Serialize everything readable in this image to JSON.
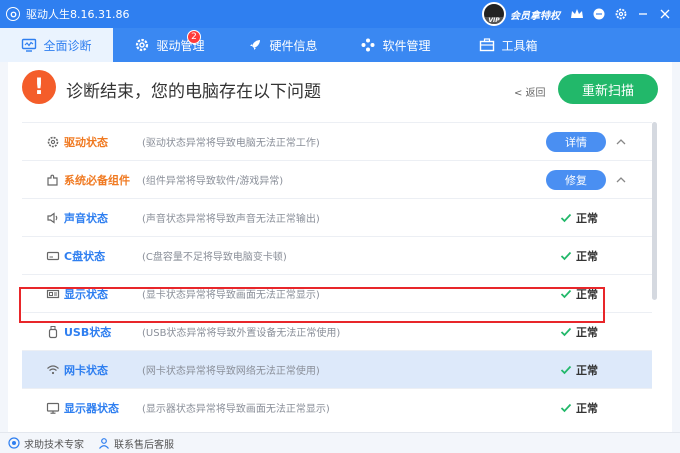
{
  "titlebar": {
    "app_title": "驱动人生8.16.31.86",
    "member_label": "会员拿特权",
    "vip_tag": "VIP"
  },
  "nav": {
    "tabs": [
      {
        "label": "全面诊断",
        "icon": "monitor-icon",
        "active": true
      },
      {
        "label": "驱动管理",
        "icon": "gear-icon",
        "badge": "2"
      },
      {
        "label": "硬件信息",
        "icon": "rocket-icon"
      },
      {
        "label": "软件管理",
        "icon": "apps-icon"
      },
      {
        "label": "工具箱",
        "icon": "toolbox-icon"
      }
    ]
  },
  "header": {
    "alert_symbol": "!",
    "title": "诊断结束，您的电脑存在以下问题",
    "back_label": "< 返回",
    "rescan_label": "重新扫描"
  },
  "rows": [
    {
      "name": "驱动状态",
      "desc": "(驱动状态异常将导致电脑无法正常工作)",
      "action": "详情",
      "icon": "gear-icon",
      "warn": true
    },
    {
      "name": "系统必备组件",
      "desc": "(组件异常将导致软件/游戏异常)",
      "action": "修复",
      "icon": "puzzle-icon",
      "warn": true
    },
    {
      "name": "声音状态",
      "desc": "(声音状态异常将导致声音无法正常输出)",
      "status": "正常",
      "icon": "speaker-icon"
    },
    {
      "name": "C盘状态",
      "desc": "(C盘容量不足将导致电脑变卡顿)",
      "status": "正常",
      "icon": "disk-icon"
    },
    {
      "name": "显示状态",
      "desc": "(显卡状态异常将导致画面无法正常显示)",
      "status": "正常",
      "icon": "gpu-icon"
    },
    {
      "name": "USB状态",
      "desc": "(USB状态异常将导致外置设备无法正常使用)",
      "status": "正常",
      "icon": "usb-icon"
    },
    {
      "name": "网卡状态",
      "desc": "(网卡状态异常将导致网络无法正常使用)",
      "status": "正常",
      "icon": "wifi-icon",
      "highlight": true
    },
    {
      "name": "显示器状态",
      "desc": "(显示器状态异常将导致画面无法正常显示)",
      "status": "正常",
      "icon": "display-icon"
    }
  ],
  "footer": {
    "help_label": "求助技术专家",
    "service_label": "联系售后客服"
  },
  "colors": {
    "primary": "#2f7ff0",
    "warn": "#f07a22",
    "ok": "#22b86a",
    "alert": "#f45d2a",
    "highlight_border": "#e8262a"
  }
}
